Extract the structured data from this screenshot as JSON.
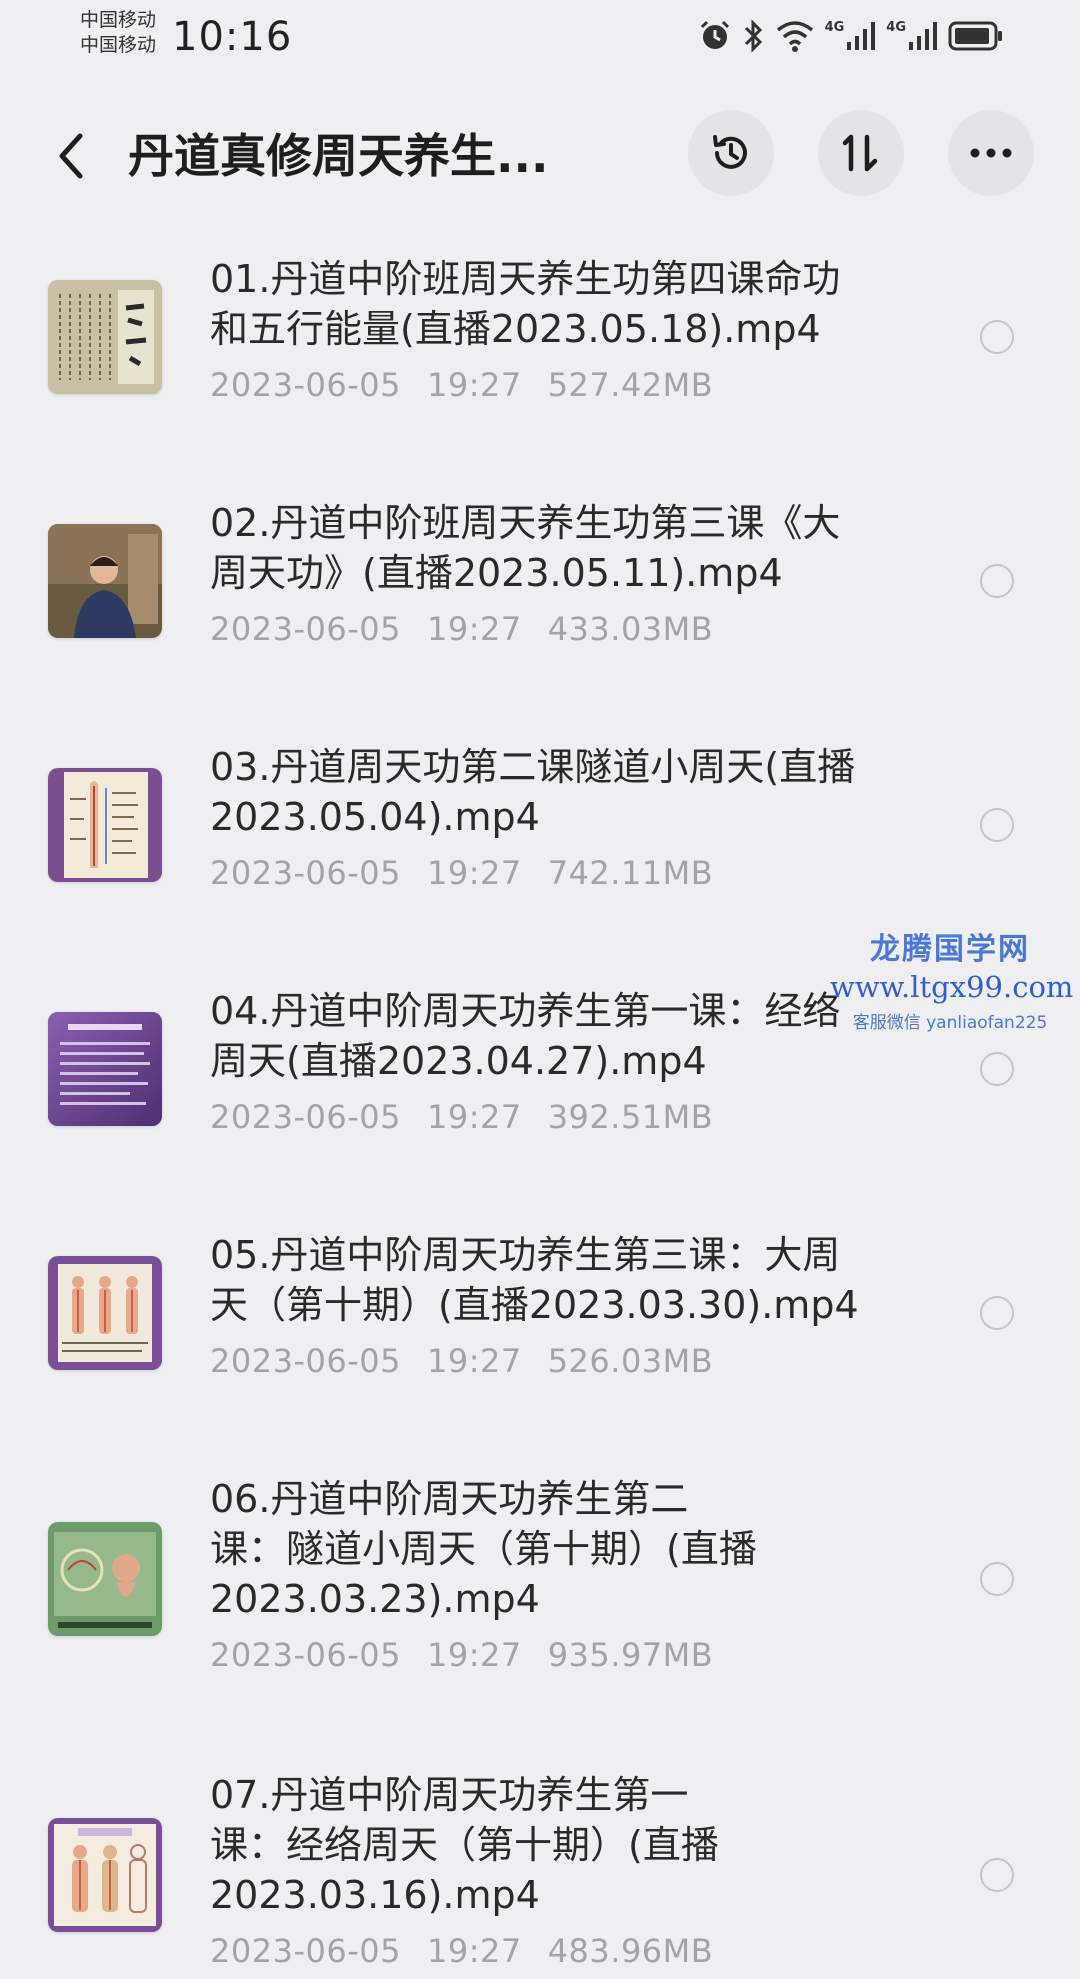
{
  "status_bar": {
    "carrier_1": "中国移动",
    "carrier_2": "中国移动",
    "time": "10:16",
    "icons": [
      "alarm-icon",
      "bluetooth-icon",
      "wifi-icon",
      "signal-4g-icon",
      "signal-4g-icon",
      "battery-icon"
    ],
    "network_label_1": "4G",
    "network_label_2": "4G"
  },
  "header": {
    "title": "丹道真修周天养生...",
    "actions": [
      "history-icon",
      "sort-icon",
      "more-icon"
    ]
  },
  "files": [
    {
      "name_line1": "01.丹道中阶班周天养生功第四课命功",
      "name_line2": "和五行能量(直播2023.05.18).mp4",
      "name_line3": "",
      "date": "2023-06-05",
      "time": "19:27",
      "size": "527.42MB",
      "thumb": "calligraphy-scroll"
    },
    {
      "name_line1": "02.丹道中阶班周天养生功第三课《大",
      "name_line2": "周天功》(直播2023.05.11).mp4",
      "name_line3": "",
      "date": "2023-06-05",
      "time": "19:27",
      "size": "433.03MB",
      "thumb": "presenter-video"
    },
    {
      "name_line1": "03.丹道周天功第二课隧道小周天(直播",
      "name_line2": "2023.05.04).mp4",
      "name_line3": "",
      "date": "2023-06-05",
      "time": "19:27",
      "size": "742.11MB",
      "thumb": "meridian-chart"
    },
    {
      "name_line1": "04.丹道中阶周天功养生第一课：经络",
      "name_line2": "周天(直播2023.04.27).mp4",
      "name_line3": "",
      "date": "2023-06-05",
      "time": "19:27",
      "size": "392.51MB",
      "thumb": "slide-text"
    },
    {
      "name_line1": "05.丹道中阶周天功养生第三课：大周",
      "name_line2": "天（第十期）(直播2023.03.30).mp4",
      "name_line3": "",
      "date": "2023-06-05",
      "time": "19:27",
      "size": "526.03MB",
      "thumb": "body-diagram"
    },
    {
      "name_line1": "06.丹道中阶周天功养生第二",
      "name_line2": "课：隧道小周天（第十期）(直播",
      "name_line3": "2023.03.23).mp4",
      "date": "2023-06-05",
      "time": "19:27",
      "size": "935.97MB",
      "thumb": "green-chart"
    },
    {
      "name_line1": "07.丹道中阶周天功养生第一",
      "name_line2": "课：经络周天（第十期）(直播",
      "name_line3": "2023.03.16).mp4",
      "date": "2023-06-05",
      "time": "19:27",
      "size": "483.96MB",
      "thumb": "anatomy-chart"
    }
  ],
  "watermark": {
    "title": "龙腾国学网",
    "url": "www.ltgx99.com",
    "contact": "客服微信 yanliaofan225"
  },
  "colors": {
    "background": "#efeff1",
    "text_primary": "#2a2a2a",
    "text_secondary": "#a3a3a8",
    "watermark": "#2d5fd2"
  }
}
